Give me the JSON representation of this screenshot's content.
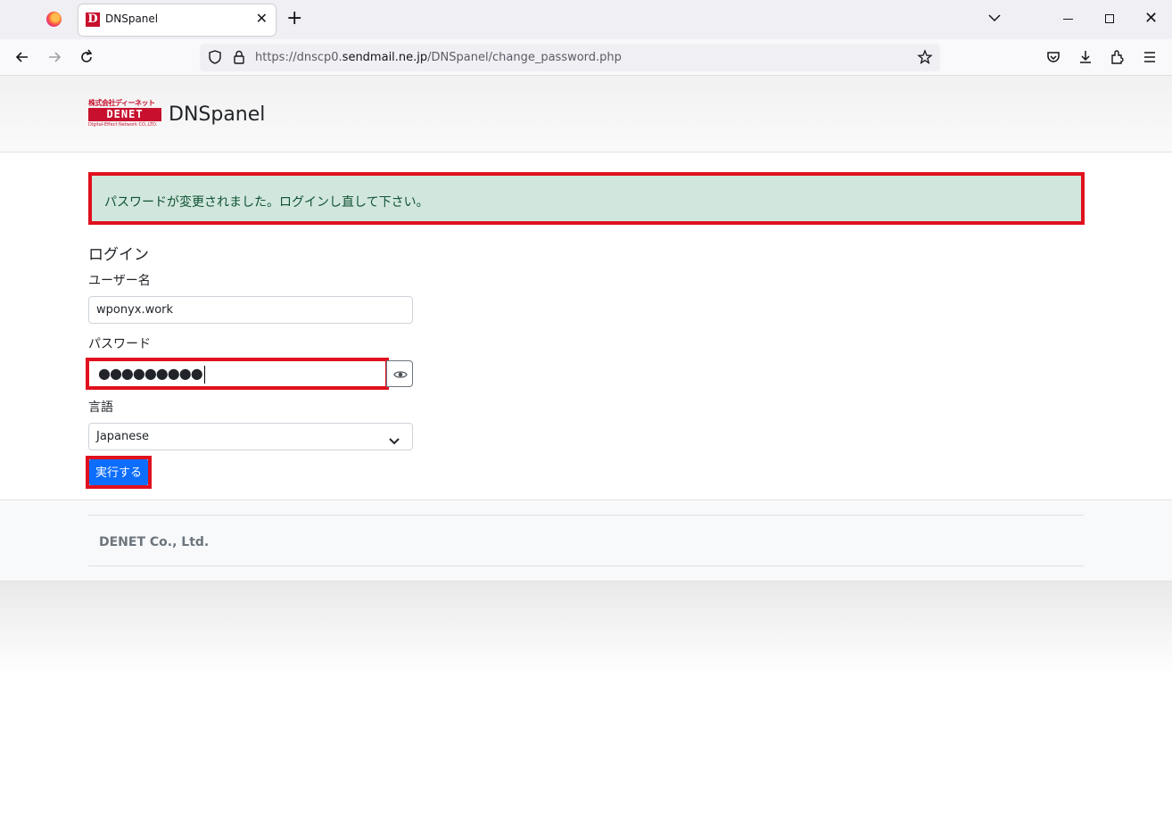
{
  "browser": {
    "tab_title": "DNSpanel",
    "tab_favicon_letter": "D",
    "new_tab_label": "+",
    "tab_close_label": "✕",
    "window_close_label": "✕",
    "url": {
      "prefix": "https://dnscp0.",
      "host": "sendmail.ne.jp",
      "path": "/DNSpanel/change_password.php"
    }
  },
  "header": {
    "logo_top": "株式会社ディーネット",
    "logo_mid": "DENET",
    "logo_bottom": "Digital-Effect Network CO.,LTD.",
    "brand": "DNSpanel"
  },
  "alert": {
    "message": "パスワードが変更されました。ログインし直して下さい。"
  },
  "login": {
    "title": "ログイン",
    "username_label": "ユーザー名",
    "username_value": "wponyx.work",
    "password_label": "パスワード",
    "password_masked": "●●●●●●●●●",
    "language_label": "言語",
    "language_value": "Japanese",
    "submit_label": "実行する"
  },
  "footer": {
    "company": "DENET Co., Ltd."
  },
  "colors": {
    "highlight_border": "#e0101e",
    "alert_bg": "#d1e7dd",
    "primary_button": "#0d6efd",
    "brand_red": "#c8102e"
  }
}
